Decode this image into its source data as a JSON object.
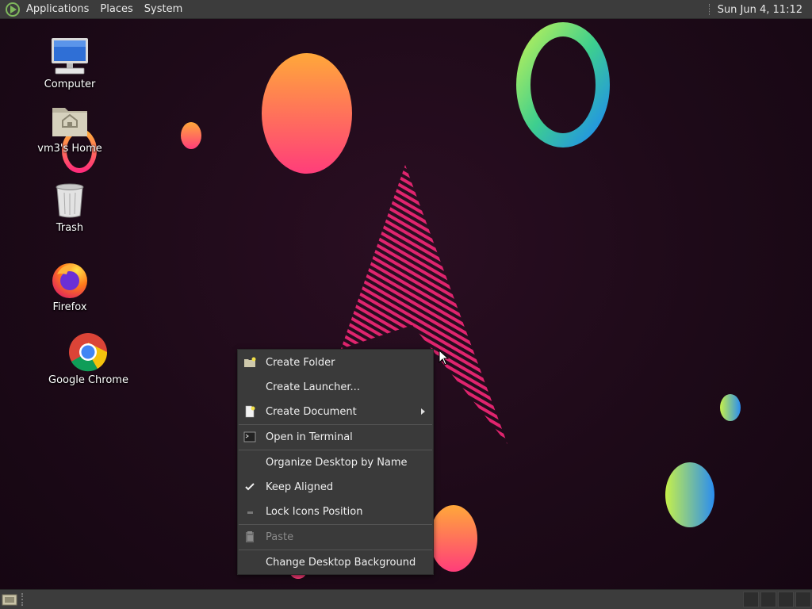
{
  "top_panel": {
    "menus": [
      {
        "label": "Applications"
      },
      {
        "label": "Places"
      },
      {
        "label": "System"
      }
    ],
    "clock": "Sun Jun  4, 11:12"
  },
  "desktop": {
    "icons": [
      {
        "label": "Computer",
        "icon": "computer-icon"
      },
      {
        "label": "vm3's Home",
        "icon": "home-folder-icon"
      },
      {
        "label": "Trash",
        "icon": "trash-icon"
      },
      {
        "label": "Firefox",
        "icon": "firefox-icon"
      },
      {
        "label": "Google Chrome",
        "icon": "chrome-icon"
      }
    ]
  },
  "context_menu": {
    "items": [
      {
        "label": "Create Folder",
        "icon": "folder-new-icon"
      },
      {
        "label": "Create Launcher..."
      },
      {
        "label": "Create Document",
        "icon": "document-new-icon",
        "submenu": true
      },
      {
        "label": "Open in Terminal",
        "icon": "terminal-icon"
      },
      {
        "label": "Organize Desktop by Name"
      },
      {
        "label": "Keep Aligned",
        "checked": true
      },
      {
        "label": "Lock Icons Position",
        "checked": false
      },
      {
        "label": "Paste",
        "icon": "paste-icon",
        "disabled": true
      },
      {
        "label": "Change Desktop Background"
      }
    ]
  },
  "colors": {
    "panel": "#3c3c3c",
    "menu_bg": "#3a3a3a",
    "wallpaper": "#1d0a18",
    "accent_pink": "#e0246e"
  }
}
